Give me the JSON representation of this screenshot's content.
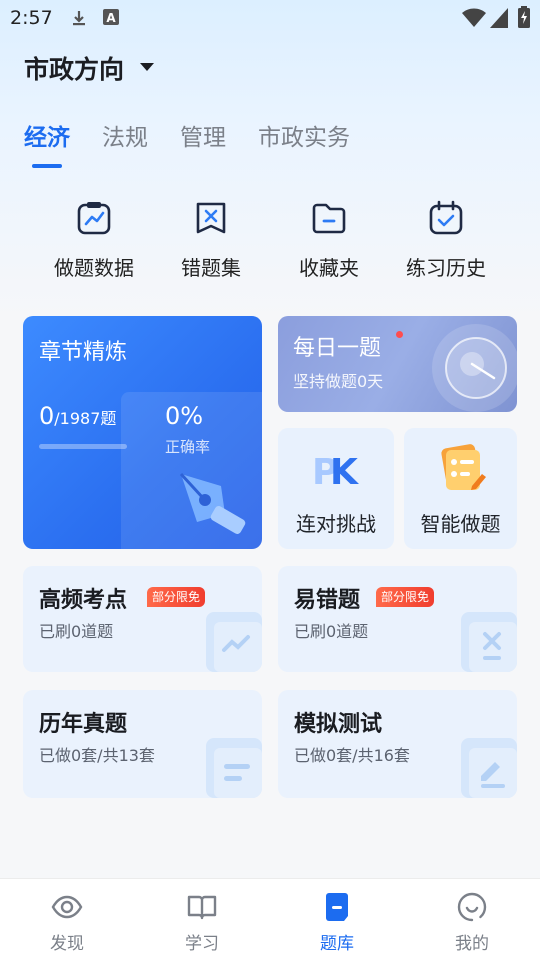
{
  "status_bar": {
    "time": "2:57"
  },
  "header": {
    "title": "市政方向"
  },
  "tabs": [
    {
      "label": "经济",
      "active": true
    },
    {
      "label": "法规",
      "active": false
    },
    {
      "label": "管理",
      "active": false
    },
    {
      "label": "市政实务",
      "active": false
    }
  ],
  "shortcuts": [
    {
      "label": "做题数据",
      "icon": "chart-board-icon"
    },
    {
      "label": "错题集",
      "icon": "wrong-bookmark-icon"
    },
    {
      "label": "收藏夹",
      "icon": "folder-icon"
    },
    {
      "label": "练习历史",
      "icon": "calendar-check-icon"
    }
  ],
  "chapter": {
    "title": "章节精炼",
    "done": "0",
    "total": "/1987题",
    "accuracy": "0%",
    "accuracy_label": "正确率",
    "progress": 0
  },
  "daily": {
    "title": "每日一题",
    "sub": "坚持做题0天"
  },
  "pk": {
    "label": "连对挑战"
  },
  "smart": {
    "label": "智能做题"
  },
  "hot": {
    "title": "高频考点",
    "badge": "部分限免",
    "sub": "已刷0道题"
  },
  "error_prone": {
    "title": "易错题",
    "badge": "部分限免",
    "sub": "已刷0道题"
  },
  "past": {
    "title": "历年真题",
    "sub": "已做0套/共13套"
  },
  "mock": {
    "title": "模拟测试",
    "sub": "已做0套/共16套"
  },
  "bottom_nav": [
    {
      "label": "发现",
      "icon": "discover-icon",
      "active": false
    },
    {
      "label": "学习",
      "icon": "book-icon",
      "active": false
    },
    {
      "label": "题库",
      "icon": "question-bank-icon",
      "active": true
    },
    {
      "label": "我的",
      "icon": "profile-icon",
      "active": false
    }
  ],
  "colors": {
    "accent": "#1c6cf0",
    "badge": "#f03d2e",
    "card_bg": "#eaf2fd"
  }
}
